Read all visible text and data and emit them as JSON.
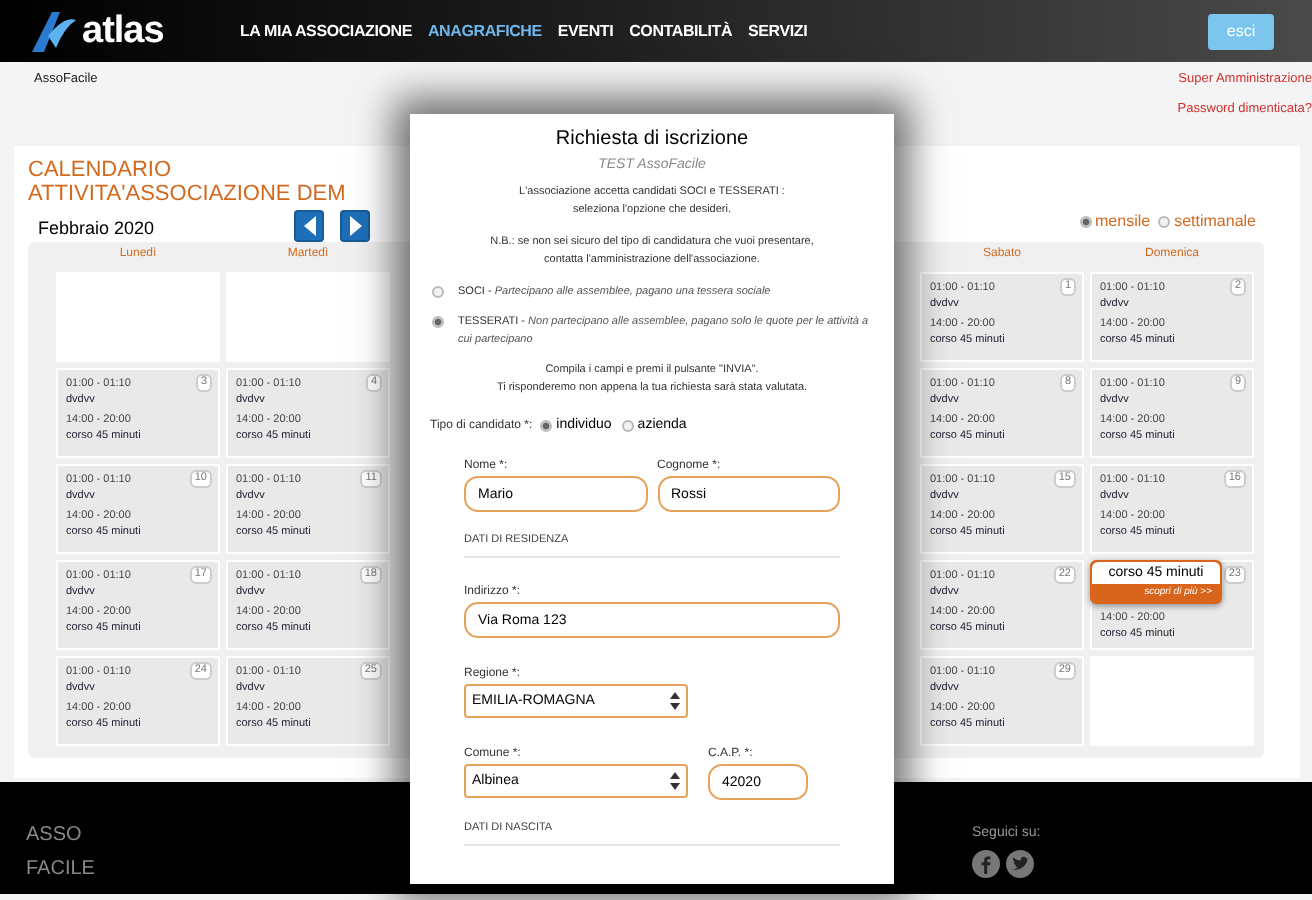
{
  "header": {
    "logo_text": "atlas",
    "nav": [
      {
        "label": "LA MIA ASSOCIAZIONE",
        "selected": false
      },
      {
        "label": "ANAGRAFICHE",
        "selected": true
      },
      {
        "label": "EVENTI",
        "selected": false
      },
      {
        "label": "CONTABILITÀ",
        "selected": false
      },
      {
        "label": "SERVIZI",
        "selected": false
      }
    ],
    "logout": "esci"
  },
  "breadcrumb": "AssoFacile",
  "links": [
    "Super Amministrazione",
    "Password dimenticata?"
  ],
  "calendar": {
    "title": "CALENDARIO ATTIVITA'ASSOCIAZIONE DEM",
    "month": "Febbraio 2020",
    "views": [
      {
        "label": "mensile",
        "selected": true
      },
      {
        "label": "settimanale",
        "selected": false
      }
    ],
    "columns": [
      {
        "day": "Lunedì",
        "cells": [
          {
            "kind": "empty"
          },
          {
            "kind": "day",
            "day": "3",
            "events": [
              {
                "time": "01:00 - 01:10",
                "title": "dvdvv"
              },
              {
                "time": "14:00 - 20:00",
                "title": "corso 45 minuti"
              }
            ]
          },
          {
            "kind": "day",
            "day": "10",
            "events": [
              {
                "time": "01:00 - 01:10",
                "title": "dvdvv"
              },
              {
                "time": "14:00 - 20:00",
                "title": "corso 45 minuti"
              }
            ]
          },
          {
            "kind": "day",
            "day": "17",
            "events": [
              {
                "time": "01:00 - 01:10",
                "title": "dvdvv"
              },
              {
                "time": "14:00 - 20:00",
                "title": "corso 45 minuti"
              }
            ]
          },
          {
            "kind": "day",
            "day": "24",
            "events": [
              {
                "time": "01:00 - 01:10",
                "title": "dvdvv"
              },
              {
                "time": "14:00 - 20:00",
                "title": "corso 45 minuti"
              }
            ]
          }
        ]
      },
      {
        "day": "Martedì",
        "cells": [
          {
            "kind": "empty"
          },
          {
            "kind": "day",
            "day": "4",
            "events": [
              {
                "time": "01:00 - 01:10",
                "title": "dvdvv"
              },
              {
                "time": "14:00 - 20:00",
                "title": "corso 45 minuti"
              }
            ]
          },
          {
            "kind": "day",
            "day": "11",
            "events": [
              {
                "time": "01:00 - 01:10",
                "title": "dvdvv"
              },
              {
                "time": "14:00 - 20:00",
                "title": "corso 45 minuti"
              }
            ]
          },
          {
            "kind": "day",
            "day": "18",
            "events": [
              {
                "time": "01:00 - 01:10",
                "title": "dvdvv"
              },
              {
                "time": "14:00 - 20:00",
                "title": "corso 45 minuti"
              }
            ]
          },
          {
            "kind": "day",
            "day": "25",
            "events": [
              {
                "time": "01:00 - 01:10",
                "title": "dvdvv"
              },
              {
                "time": "14:00 - 20:00",
                "title": "corso 45 minuti"
              }
            ]
          }
        ]
      },
      {
        "day": "Sabato",
        "cells": [
          {
            "kind": "day",
            "day": "1",
            "events": [
              {
                "time": "01:00 - 01:10",
                "title": "dvdvv"
              },
              {
                "time": "14:00 - 20:00",
                "title": "corso 45 minuti"
              }
            ]
          },
          {
            "kind": "day",
            "day": "8",
            "events": [
              {
                "time": "01:00 - 01:10",
                "title": "dvdvv"
              },
              {
                "time": "14:00 - 20:00",
                "title": "corso 45 minuti"
              }
            ]
          },
          {
            "kind": "day",
            "day": "15",
            "events": [
              {
                "time": "01:00 - 01:10",
                "title": "dvdvv"
              },
              {
                "time": "14:00 - 20:00",
                "title": "corso 45 minuti"
              }
            ]
          },
          {
            "kind": "day",
            "day": "22",
            "events": [
              {
                "time": "01:00 - 01:10",
                "title": "dvdvv"
              },
              {
                "time": "14:00 - 20:00",
                "title": "corso 45 minuti"
              }
            ]
          },
          {
            "kind": "day",
            "day": "29",
            "events": [
              {
                "time": "01:00 - 01:10",
                "title": "dvdvv"
              },
              {
                "time": "14:00 - 20:00",
                "title": "corso 45 minuti"
              }
            ]
          }
        ]
      },
      {
        "day": "Domenica",
        "cells": [
          {
            "kind": "day",
            "day": "2",
            "events": [
              {
                "time": "01:00 - 01:10",
                "title": "dvdvv"
              },
              {
                "time": "14:00 - 20:00",
                "title": "corso 45 minuti"
              }
            ]
          },
          {
            "kind": "day",
            "day": "9",
            "events": [
              {
                "time": "01:00 - 01:10",
                "title": "dvdvv"
              },
              {
                "time": "14:00 - 20:00",
                "title": "corso 45 minuti"
              }
            ]
          },
          {
            "kind": "day",
            "day": "16",
            "events": [
              {
                "time": "01:00 - 01:10",
                "title": "dvdvv"
              },
              {
                "time": "14:00 - 20:00",
                "title": "corso 45 minuti"
              }
            ]
          },
          {
            "kind": "popup",
            "day": "23",
            "popup": {
              "title": "corso 45 minuti",
              "link": "scopri di più >>"
            },
            "events": [
              {
                "time": "14:00 - 20:00",
                "title": "corso 45 minuti"
              }
            ]
          },
          {
            "kind": "empty"
          }
        ]
      }
    ]
  },
  "modal": {
    "title": "Richiesta di iscrizione",
    "subtitle": "TEST AssoFacile",
    "intro": [
      "L'associazione accetta candidati SOCI e TESSERATI :",
      "seleziona l'opzione che desideri."
    ],
    "note": [
      "N.B.: se non sei sicuro del tipo di candidatura che vuoi presentare,",
      "contatta l'amministrazione dell'associazione."
    ],
    "options": [
      {
        "text": "SOCI - *Partecipano alle assemblee, pagano una tessera sociale*",
        "selected": false
      },
      {
        "text": "TESSERATI - *Non partecipano alle assemblee, pagano solo le quote per le attività a cui partecipano*",
        "selected": true
      }
    ],
    "instructions": [
      "Compila i campi e premi il pulsante \"INVIA\".",
      "Ti risponderemo non appena la tua richiesta sarà stata valutata."
    ],
    "type_label": "Tipo di candidato *:",
    "types": [
      {
        "label": "individuo",
        "selected": true
      },
      {
        "label": "azienda",
        "selected": false
      }
    ],
    "rows": [
      {
        "kind": "fields",
        "fields": [
          {
            "kind": "input",
            "label": "Nome *:",
            "value": "Mario"
          },
          {
            "kind": "input",
            "label": "Cognome *:",
            "value": "Rossi"
          }
        ]
      },
      {
        "kind": "heading",
        "text": "DATI DI RESIDENZA"
      },
      {
        "kind": "fields",
        "fields": [
          {
            "kind": "input",
            "label": "Indirizzo *:",
            "value": "Via Roma 123"
          }
        ]
      },
      {
        "kind": "fields",
        "fields": [
          {
            "kind": "select",
            "label": "Regione *:",
            "value": "EMILIA-ROMAGNA"
          }
        ]
      },
      {
        "kind": "fields",
        "fields": [
          {
            "kind": "select",
            "label": "Comune *:",
            "value": "Albinea"
          },
          {
            "kind": "input",
            "label": "C.A.P. *:",
            "value": "42020"
          }
        ]
      },
      {
        "kind": "heading",
        "text": "DATI DI NASCITA"
      }
    ]
  },
  "footer": {
    "brand": [
      "ASSO",
      "FACILE"
    ],
    "follow": "Seguici su:"
  }
}
